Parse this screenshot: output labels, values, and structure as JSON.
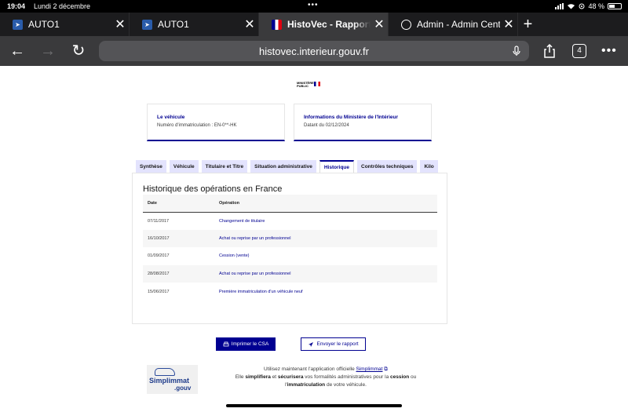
{
  "status_bar": {
    "time": "19:04",
    "date": "Lundi 2 décembre",
    "battery": "48 %"
  },
  "tabs": [
    {
      "title": "AUTO1",
      "favicon": "auto1-icon"
    },
    {
      "title": "AUTO1",
      "favicon": "auto1-icon"
    },
    {
      "title": "HistoVec - Rapport vendeur",
      "favicon": "french-flag-icon",
      "active": true
    },
    {
      "title": "Admin - Admin Center",
      "favicon": "globe-icon"
    }
  ],
  "toolbar": {
    "url": "histovec.interieur.gouv.fr",
    "tab_count": "4"
  },
  "cards": {
    "vehicle": {
      "heading": "Le véhicule",
      "value": "Numéro d'immatriculation : EN-0**-HK"
    },
    "ministry": {
      "heading": "Informations du Ministère de l'Intérieur",
      "value": "Datant du 02/12/2024"
    }
  },
  "report_tabs": [
    "Synthèse",
    "Véhicule",
    "Titulaire et Titre",
    "Situation administrative",
    "Historique",
    "Contrôles techniques",
    "Kilo"
  ],
  "history": {
    "title": "Historique des opérations en France",
    "columns": [
      "Date",
      "Opération"
    ],
    "rows": [
      {
        "date": "07/11/2017",
        "operation": "Changement de titulaire"
      },
      {
        "date": "16/10/2017",
        "operation": "Achat ou reprise par un professionnel"
      },
      {
        "date": "01/09/2017",
        "operation": "Cession (vente)"
      },
      {
        "date": "28/08/2017",
        "operation": "Achat ou reprise par un professionnel"
      },
      {
        "date": "15/06/2017",
        "operation": "Première immatriculation d'un véhicule neuf"
      }
    ]
  },
  "buttons": {
    "print": "Imprimer le CSA",
    "send": "Envoyer le rapport"
  },
  "simplimmat": {
    "logo_name": "Simplimmat",
    "logo_suffix": ".gouv",
    "line1": "Utilisez maintenant l'application officielle",
    "link": "Simplimmat",
    "line2a": "Elle",
    "b1": "simplifiera",
    "line2b": "et",
    "b2": "sécurisera",
    "line2c": "vos formalités administratives pour la",
    "b3": "cession",
    "line2d": "ou",
    "line3a": "l'",
    "b4": "immatriculation",
    "line3b": "de votre véhicule."
  }
}
